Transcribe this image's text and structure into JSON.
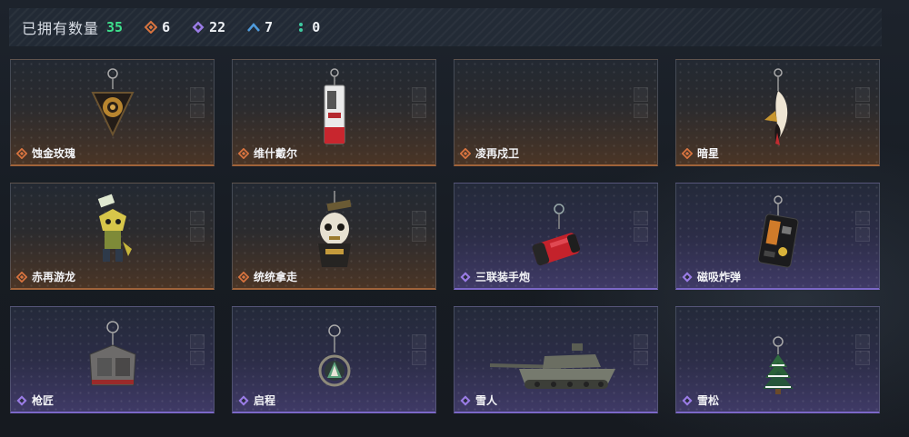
{
  "header": {
    "owned_label": "已拥有数量",
    "owned_count": "35",
    "stats": [
      {
        "icon": "orange-diamond-icon",
        "color": "#d9743f",
        "value": "6"
      },
      {
        "icon": "purple-diamond-icon",
        "color": "#9a7ce6",
        "value": "22"
      },
      {
        "icon": "blue-chevron-icon",
        "color": "#4f9bdc",
        "value": "7"
      },
      {
        "icon": "green-dots-icon",
        "color": "#3ec9a0",
        "value": "0"
      }
    ]
  },
  "colors": {
    "orange_rarity": "#d9743f",
    "purple_rarity": "#9a7ce6",
    "owned_count": "#3ee08c"
  },
  "items": [
    {
      "name": "蚀金玫瑰",
      "rarity": "orange",
      "art": "rose-badge-charm"
    },
    {
      "name": "维什戴尔",
      "rarity": "orange",
      "art": "tag-charm"
    },
    {
      "name": "凌再戍卫",
      "rarity": "orange",
      "art": "none"
    },
    {
      "name": "暗星",
      "rarity": "orange",
      "art": "feather-charm"
    },
    {
      "name": "赤再游龙",
      "rarity": "orange",
      "art": "dragon-figure-charm"
    },
    {
      "name": "统统拿走",
      "rarity": "orange",
      "art": "skull-figure-charm"
    },
    {
      "name": "三联装手炮",
      "rarity": "purple",
      "art": "rocket-charm"
    },
    {
      "name": "磁吸炸弹",
      "rarity": "purple",
      "art": "bomb-charm"
    },
    {
      "name": "枪匠",
      "rarity": "purple",
      "art": "crate-charm"
    },
    {
      "name": "启程",
      "rarity": "purple",
      "art": "ring-medal-charm"
    },
    {
      "name": "雪人",
      "rarity": "purple",
      "art": "tank-charm"
    },
    {
      "name": "雪松",
      "rarity": "purple",
      "art": "pine-tree-charm"
    }
  ]
}
